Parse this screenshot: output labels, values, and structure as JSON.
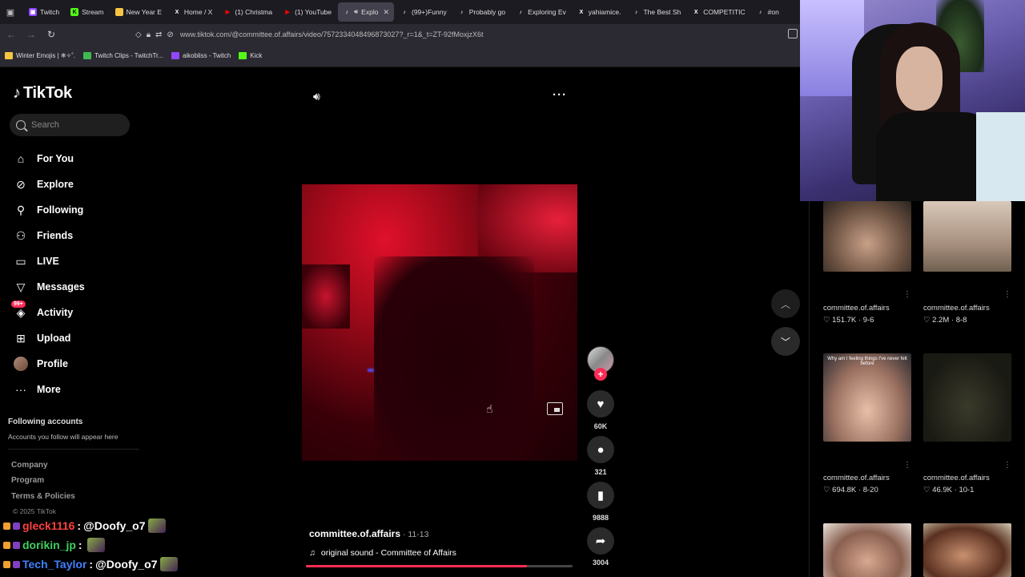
{
  "browser": {
    "tabs": [
      {
        "label": "Twitch",
        "icon": "twitch-icon",
        "color": "#9146ff"
      },
      {
        "label": "Stream",
        "icon": "kick-icon",
        "color": "#53fc18"
      },
      {
        "label": "New Year E",
        "icon": "folder-icon",
        "color": "#f5c542"
      },
      {
        "label": "Home / X",
        "icon": "x-icon",
        "color": "#ffffff"
      },
      {
        "label": "(1) Christma",
        "icon": "youtube-icon",
        "color": "#ff0000"
      },
      {
        "label": "(1) YouTube",
        "icon": "youtube-icon",
        "color": "#ff0000"
      },
      {
        "label": "Explo",
        "icon": "tiktok-icon",
        "color": "#ffffff",
        "active": true
      },
      {
        "label": "(99+)Funny",
        "icon": "tiktok-icon",
        "color": "#ffffff"
      },
      {
        "label": "Probably go",
        "icon": "tiktok-icon",
        "color": "#ffffff"
      },
      {
        "label": "Exploring Ev",
        "icon": "tiktok-icon",
        "color": "#ffffff"
      },
      {
        "label": "yahiamice.",
        "icon": "x-icon",
        "color": "#ffffff"
      },
      {
        "label": "The Best Sh",
        "icon": "tiktok-icon",
        "color": "#ffffff"
      },
      {
        "label": "COMPETITIC",
        "icon": "x-icon",
        "color": "#ffffff"
      },
      {
        "label": "#on",
        "icon": "tiktok-icon",
        "color": "#ffffff"
      }
    ],
    "url": "www.tiktok.com/@committee.of.affairs/video/7572334048496873027?_r=1&_t=ZT-92fMoxjzX6t",
    "bookmarks": [
      {
        "label": "Winter Emojis | ❄✧˚.",
        "color": "#f5c542"
      },
      {
        "label": "Twitch Clips - TwitchTr...",
        "color": "#3fb950"
      },
      {
        "label": "aikobliss - Twitch",
        "color": "#9146ff"
      },
      {
        "label": "Kick",
        "color": "#53fc18"
      }
    ]
  },
  "tiktok": {
    "logo": "TikTok",
    "search_placeholder": "Search",
    "nav": [
      {
        "label": "For You",
        "icon": "home-icon"
      },
      {
        "label": "Explore",
        "icon": "compass-icon"
      },
      {
        "label": "Following",
        "icon": "following-icon"
      },
      {
        "label": "Friends",
        "icon": "friends-icon"
      },
      {
        "label": "LIVE",
        "icon": "live-icon"
      },
      {
        "label": "Messages",
        "icon": "messages-icon"
      },
      {
        "label": "Activity",
        "icon": "activity-icon",
        "badge": "99+"
      },
      {
        "label": "Upload",
        "icon": "upload-icon"
      },
      {
        "label": "Profile",
        "icon": "profile-avatar"
      },
      {
        "label": "More",
        "icon": "more-icon"
      }
    ],
    "following_title": "Following accounts",
    "following_sub": "Accounts you follow will appear here",
    "footer_links": [
      "Company",
      "Program",
      "Terms & Policies"
    ],
    "copyright": "© 2025 TikTok",
    "accent": "#fe2c55"
  },
  "video": {
    "author": "committee.of.affairs",
    "date": " · 11-13",
    "sound": "original sound - Committee of Affairs",
    "progress": 0.83,
    "likes": "60K",
    "comments": "321",
    "saves": "9888",
    "shares": "3004"
  },
  "related": [
    {
      "author": "committee.of.affairs",
      "likes": "151.7K",
      "date": "9-6"
    },
    {
      "author": "committee.of.affairs",
      "likes": "2.2M",
      "date": "8-8"
    },
    {
      "author": "committee.of.affairs",
      "likes": "694.8K",
      "date": "8-20",
      "caption": "Why am I feeling things I've never felt before"
    },
    {
      "author": "committee.of.affairs",
      "likes": "46.9K",
      "date": "10-1"
    }
  ],
  "chat": [
    {
      "user": "gleck1116",
      "user_color": "#ff4040",
      "message": "@Doofy_o7"
    },
    {
      "user": "dorikin_jp",
      "user_color": "#40d060",
      "message": ""
    },
    {
      "user": "Tech_Taylor",
      "user_color": "#4080ff",
      "message": "@Doofy_o7"
    }
  ]
}
